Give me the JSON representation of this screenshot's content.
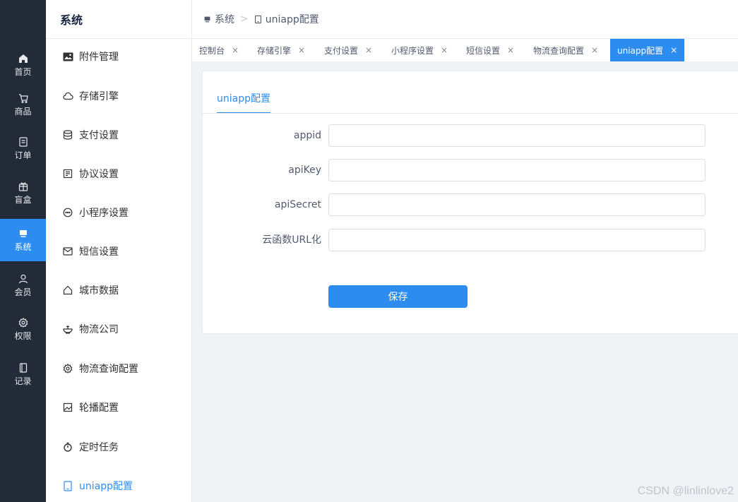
{
  "nav": {
    "items": [
      {
        "label": "首页",
        "icon": "home-icon"
      },
      {
        "label": "商品",
        "icon": "cart-icon"
      },
      {
        "label": "订单",
        "icon": "order-icon"
      },
      {
        "label": "盲盒",
        "icon": "gift-icon"
      },
      {
        "label": "系统",
        "icon": "monitor-icon",
        "active": true
      },
      {
        "label": "会员",
        "icon": "user-icon"
      },
      {
        "label": "权限",
        "icon": "gear-icon"
      },
      {
        "label": "记录",
        "icon": "book-icon"
      }
    ]
  },
  "submenu": {
    "title": "系统",
    "items": [
      {
        "label": "附件管理",
        "icon": "image-icon"
      },
      {
        "label": "存储引擎",
        "icon": "cloud-icon"
      },
      {
        "label": "支付设置",
        "icon": "database-icon"
      },
      {
        "label": "协议设置",
        "icon": "document-icon"
      },
      {
        "label": "小程序设置",
        "icon": "chat-icon"
      },
      {
        "label": "短信设置",
        "icon": "mail-icon"
      },
      {
        "label": "城市数据",
        "icon": "house-icon"
      },
      {
        "label": "物流公司",
        "icon": "bowl-icon"
      },
      {
        "label": "物流查询配置",
        "icon": "gear-icon"
      },
      {
        "label": "轮播配置",
        "icon": "picture-icon"
      },
      {
        "label": "定时任务",
        "icon": "stopwatch-icon"
      },
      {
        "label": "uniapp配置",
        "icon": "tablet-icon",
        "active": true
      }
    ]
  },
  "breadcrumb": {
    "root": "系统",
    "separator": ">",
    "current": "uniapp配置"
  },
  "tabs": [
    {
      "label": "控制台"
    },
    {
      "label": "存储引擎"
    },
    {
      "label": "支付设置"
    },
    {
      "label": "小程序设置"
    },
    {
      "label": "短信设置"
    },
    {
      "label": "物流查询配置"
    },
    {
      "label": "uniapp配置",
      "active": true
    }
  ],
  "tab_close": "×",
  "form": {
    "tab_label": "uniapp配置",
    "fields": [
      {
        "label": "appid",
        "value": ""
      },
      {
        "label": "apiKey",
        "value": ""
      },
      {
        "label": "apiSecret",
        "value": ""
      },
      {
        "label": "云函数URL化",
        "value": ""
      }
    ],
    "save_label": "保存"
  },
  "watermark": "CSDN @linlinlove2",
  "colors": {
    "accent": "#2d8cf0",
    "nav_bg": "#232a38",
    "page_bg": "#f0f2f5"
  }
}
